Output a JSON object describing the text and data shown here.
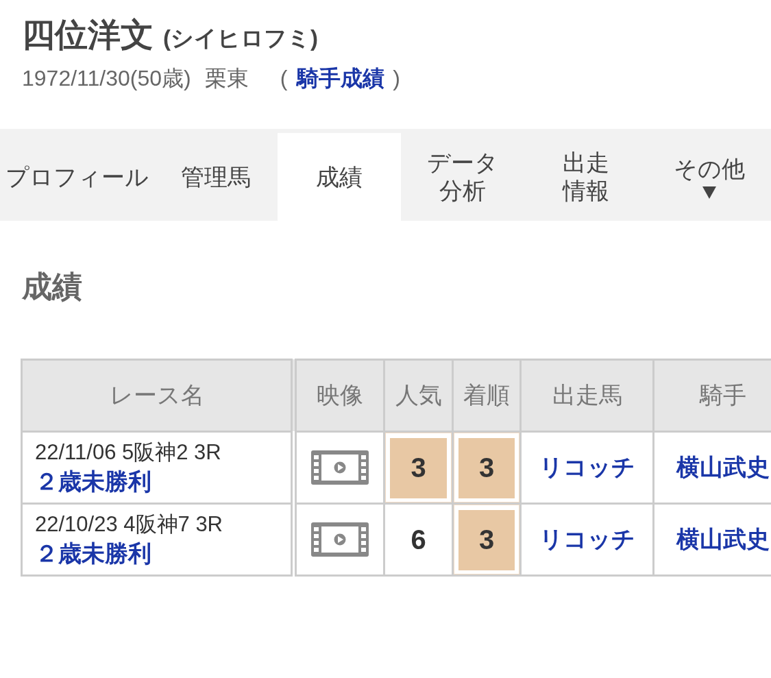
{
  "profile": {
    "name": "四位洋文",
    "reading": "(シイヒロフミ)",
    "birth": "1972/11/30(50歳)",
    "affiliation": "栗東",
    "open_paren": "(",
    "link": "騎手成績",
    "close_paren": ")"
  },
  "tabs": [
    {
      "lines": [
        "プロフィール"
      ],
      "selected": false,
      "has_menu": false
    },
    {
      "lines": [
        "管理馬"
      ],
      "selected": false,
      "has_menu": false
    },
    {
      "lines": [
        "成績"
      ],
      "selected": true,
      "has_menu": false
    },
    {
      "lines": [
        "データ",
        "分析"
      ],
      "selected": false,
      "has_menu": false
    },
    {
      "lines": [
        "出走",
        "情報"
      ],
      "selected": false,
      "has_menu": false
    },
    {
      "lines": [
        "その他"
      ],
      "selected": false,
      "has_menu": true
    }
  ],
  "section_title": "成績",
  "table": {
    "columns": [
      "レース名",
      "映像",
      "人気",
      "着順",
      "出走馬",
      "騎手"
    ],
    "rows": [
      {
        "date_venue": "22/11/06 5阪神2 3R",
        "race": "２歳未勝利",
        "video": true,
        "popularity": {
          "value": "3",
          "highlighted": true
        },
        "finish": {
          "value": "3",
          "highlighted": true
        },
        "horse": "リコッチ",
        "jockey": "横山武史"
      },
      {
        "date_venue": "22/10/23 4阪神7 3R",
        "race": "２歳未勝利",
        "video": true,
        "popularity": {
          "value": "6",
          "highlighted": false
        },
        "finish": {
          "value": "3",
          "highlighted": true
        },
        "horse": "リコッチ",
        "jockey": "横山武史"
      }
    ]
  }
}
